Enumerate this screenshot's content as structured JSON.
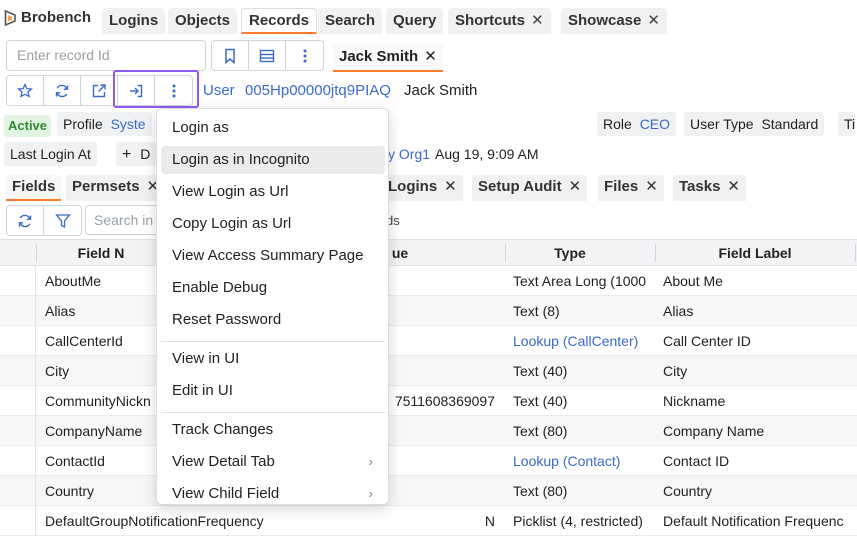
{
  "app": {
    "name": "Brobench"
  },
  "nav_tabs": [
    {
      "label": "Logins",
      "active": false,
      "closable": false
    },
    {
      "label": "Objects",
      "active": false,
      "closable": false
    },
    {
      "label": "Records",
      "active": true,
      "closable": false
    },
    {
      "label": "Search",
      "active": false,
      "closable": false
    },
    {
      "label": "Query",
      "active": false,
      "closable": false
    },
    {
      "label": "Shortcuts",
      "active": false,
      "closable": true
    },
    {
      "label": "Showcase",
      "active": false,
      "closable": true
    }
  ],
  "close_glyph": "✕",
  "record_search": {
    "placeholder": "Enter record Id"
  },
  "record_tab": {
    "label": "Jack Smith"
  },
  "record": {
    "object_label": "User",
    "id": "005Hp00000jtq9PIAQ",
    "name": "Jack Smith",
    "status": "Active",
    "profile_label": "Profile",
    "profile_value": "Syste",
    "role_label": "Role",
    "role_value": "CEO",
    "user_type_label": "User Type",
    "user_type_value": "Standard",
    "extra_label": "Ti",
    "last_login_label": "Last Login At",
    "add_glyph": "+",
    "add_partial": "D",
    "org_partial": "y Org1",
    "last_login_value": "Aug 19, 9:09 AM"
  },
  "sub_tabs": [
    {
      "label": "Fields",
      "active": true,
      "closable": false
    },
    {
      "label": "Permsets",
      "active": false,
      "closable": true
    },
    {
      "label": "Logins",
      "active": false,
      "closable": true
    },
    {
      "label": "Setup Audit",
      "active": false,
      "closable": true
    },
    {
      "label": "Files",
      "active": false,
      "closable": true
    },
    {
      "label": "Tasks",
      "active": false,
      "closable": true
    }
  ],
  "field_search": {
    "placeholder": "Search in",
    "suffix": "ds"
  },
  "table": {
    "headers": {
      "field": "Field N",
      "value": "ue",
      "type": "Type",
      "label": "Field Label"
    },
    "rows": [
      {
        "name": "AboutMe",
        "value": "",
        "type": "Text Area Long (1000",
        "type_link": false,
        "label": "About Me"
      },
      {
        "name": "Alias",
        "value": "",
        "type": "Text (8)",
        "type_link": false,
        "label": "Alias"
      },
      {
        "name": "CallCenterId",
        "value": "",
        "type": "Lookup (CallCenter)",
        "type_link": true,
        "label": "Call Center ID"
      },
      {
        "name": "City",
        "value": "",
        "type": "Text (40)",
        "type_link": false,
        "label": "City"
      },
      {
        "name": "CommunityNickn",
        "value": "7511608369097",
        "type": "Text (40)",
        "type_link": false,
        "label": "Nickname"
      },
      {
        "name": "CompanyName",
        "value": "",
        "type": "Text (80)",
        "type_link": false,
        "label": "Company Name"
      },
      {
        "name": "ContactId",
        "value": "",
        "type": "Lookup (Contact)",
        "type_link": true,
        "label": "Contact ID"
      },
      {
        "name": "Country",
        "value": "",
        "type": "Text (80)",
        "type_link": false,
        "label": "Country"
      },
      {
        "name": "DefaultGroupNotificationFrequency",
        "value": "N",
        "type": "Picklist (4, restricted)",
        "type_link": false,
        "label": "Default Notification Frequenc"
      }
    ]
  },
  "menu": {
    "groups": [
      [
        {
          "label": "Login as",
          "submenu": false,
          "hover": false
        },
        {
          "label": "Login as in Incognito",
          "submenu": false,
          "hover": true
        },
        {
          "label": "View Login as Url",
          "submenu": false,
          "hover": false
        },
        {
          "label": "Copy Login as Url",
          "submenu": false,
          "hover": false
        },
        {
          "label": "View Access Summary Page",
          "submenu": false,
          "hover": false
        },
        {
          "label": "Enable Debug",
          "submenu": false,
          "hover": false
        },
        {
          "label": "Reset Password",
          "submenu": false,
          "hover": false
        }
      ],
      [
        {
          "label": "View in UI",
          "submenu": false,
          "hover": false
        },
        {
          "label": "Edit in UI",
          "submenu": false,
          "hover": false
        }
      ],
      [
        {
          "label": "Track Changes",
          "submenu": false,
          "hover": false
        },
        {
          "label": "View Detail Tab",
          "submenu": true,
          "hover": false
        },
        {
          "label": "View Child Field",
          "submenu": true,
          "hover": false
        }
      ]
    ],
    "submenu_glyph": "›"
  },
  "colors": {
    "accent": "#ff7b2e",
    "link": "#3a6bc7",
    "highlight": "#8e5bf0",
    "active_badge": "#2f8a2f"
  }
}
